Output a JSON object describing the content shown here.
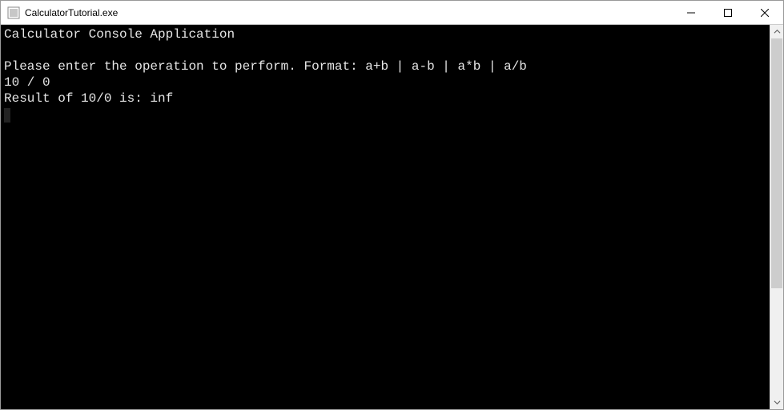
{
  "window": {
    "title": "CalculatorTutorial.exe"
  },
  "console": {
    "lines": [
      "Calculator Console Application",
      "",
      "Please enter the operation to perform. Format: a+b | a-b | a*b | a/b",
      "10 / 0",
      "Result of 10/0 is: inf"
    ]
  }
}
